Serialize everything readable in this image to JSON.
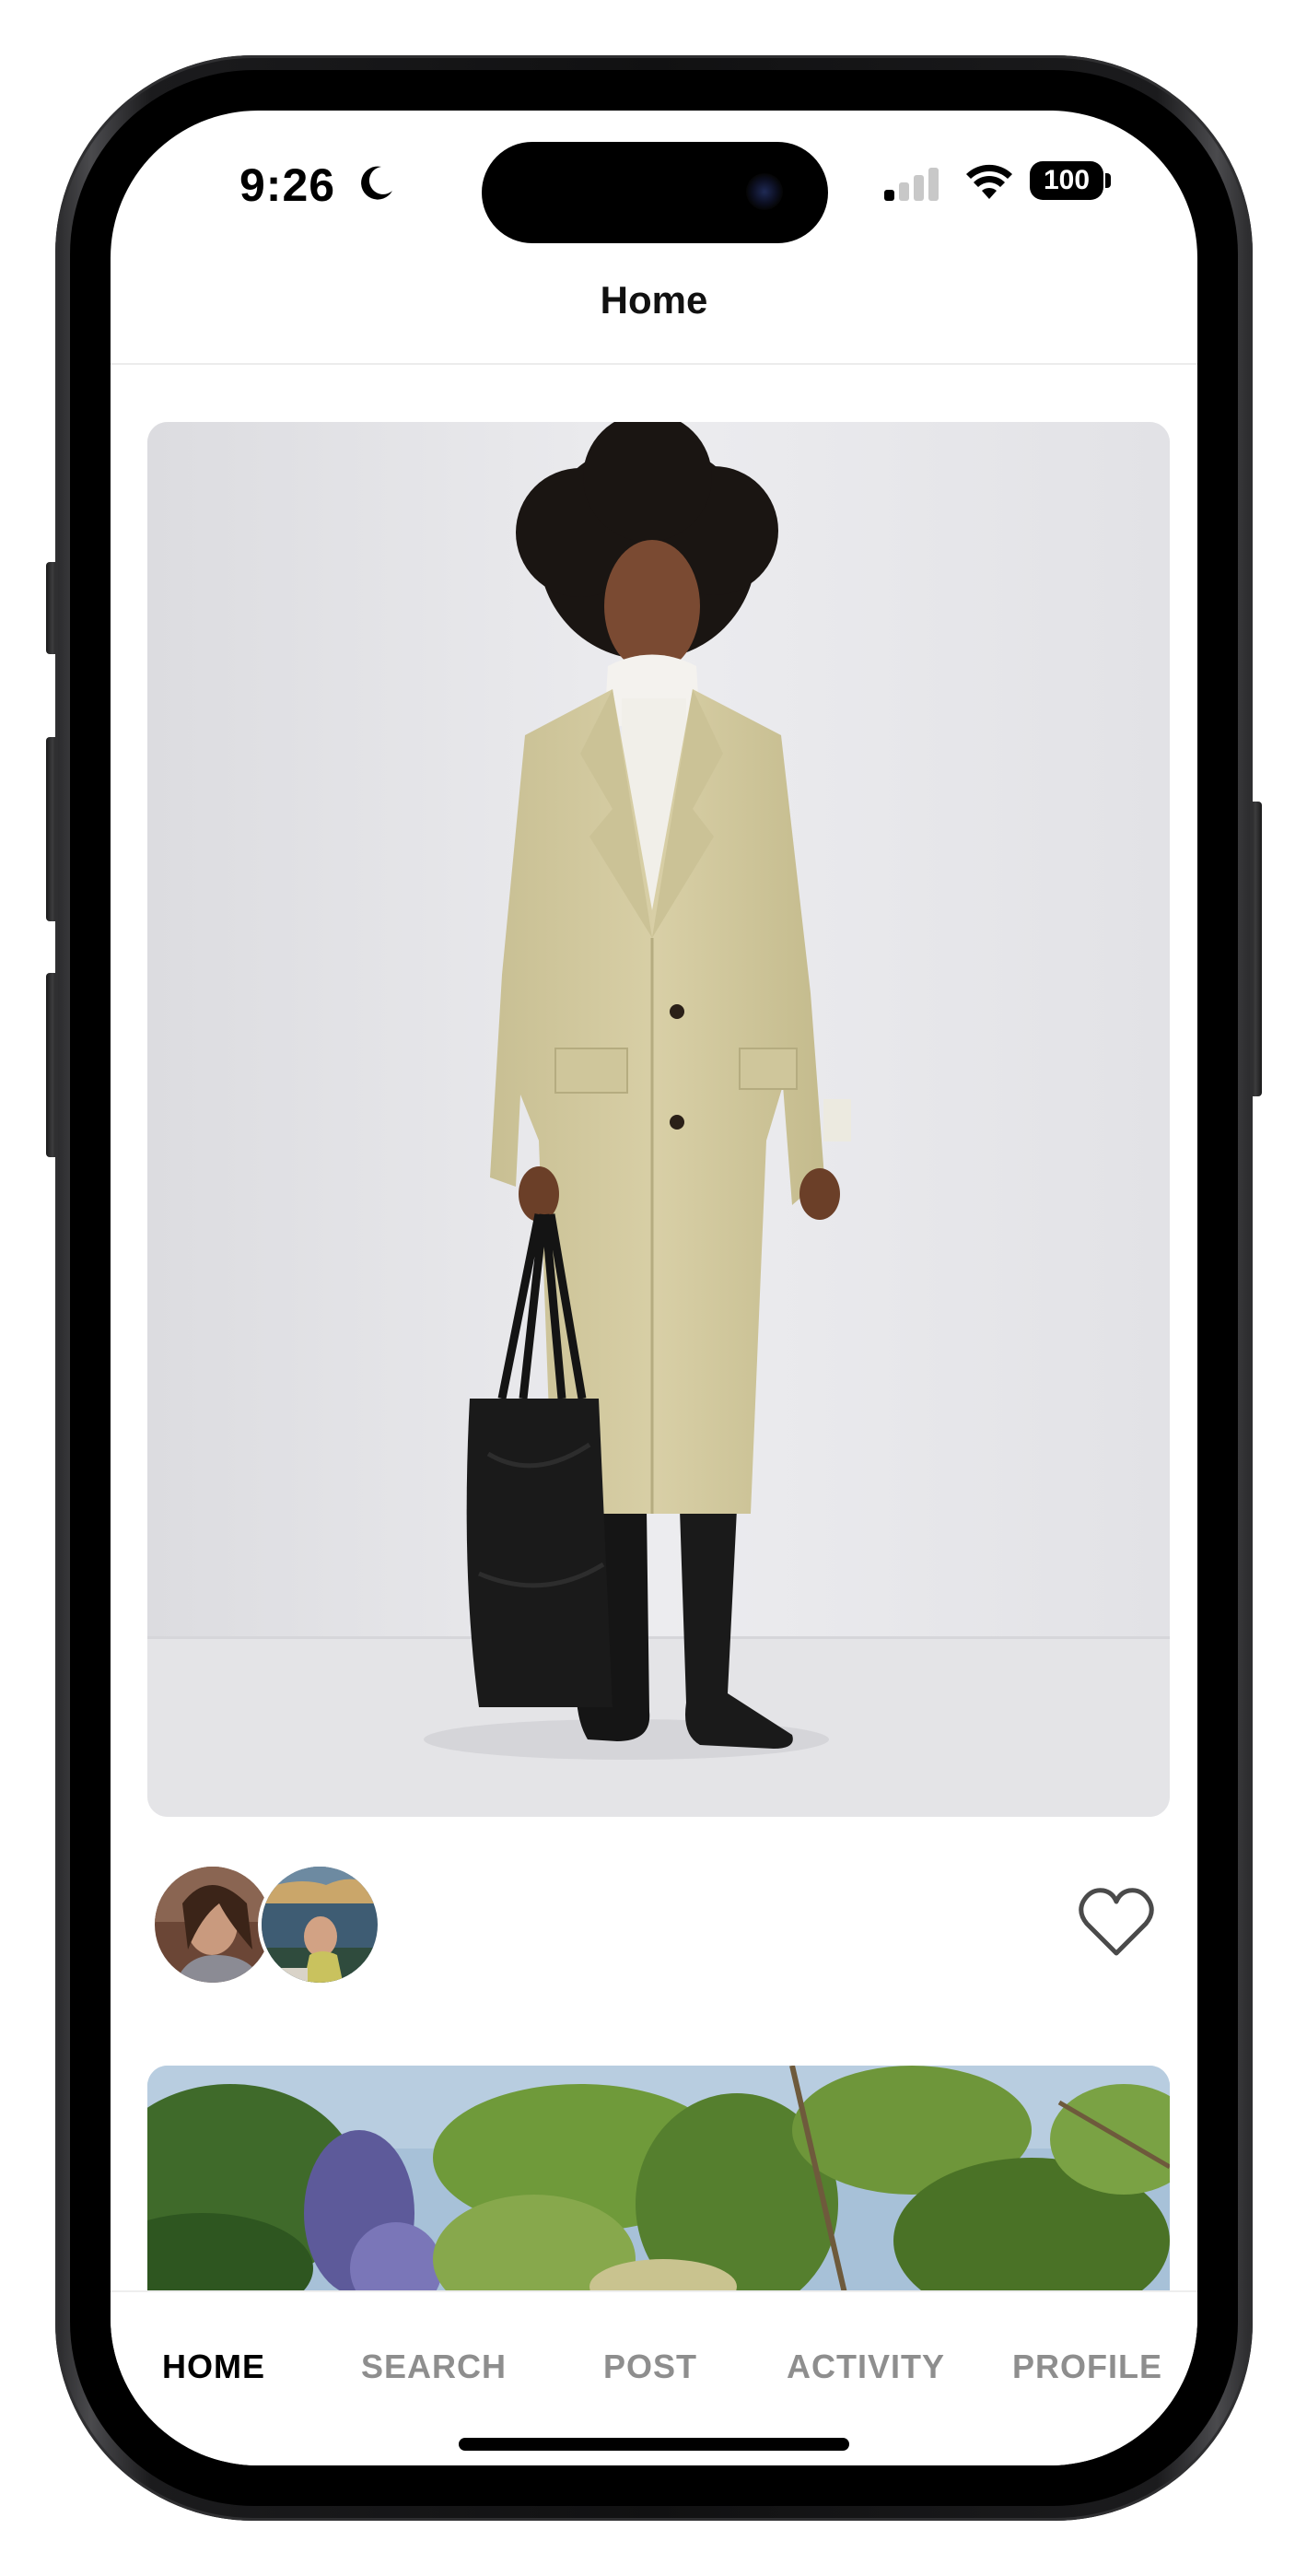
{
  "status_bar": {
    "time": "9:26",
    "battery": "100",
    "icons": [
      "moon-icon",
      "signal-icon",
      "wifi-icon",
      "battery-icon"
    ]
  },
  "header": {
    "title": "Home"
  },
  "feed": {
    "posts": [
      {
        "avatars": [
          "avatar-1",
          "avatar-2"
        ],
        "liked": false,
        "like_icon": "heart-outline-icon"
      }
    ]
  },
  "tabbar": {
    "tabs": [
      {
        "label": "HOME",
        "active": true
      },
      {
        "label": "SEARCH",
        "active": false
      },
      {
        "label": "POST",
        "active": false
      },
      {
        "label": "ACTIVITY",
        "active": false
      },
      {
        "label": "PROFILE",
        "active": false
      }
    ]
  },
  "colors": {
    "active_tab": "#000000",
    "inactive_tab": "#8e8e8e",
    "coat": "#d2c9a0",
    "background": "#ffffff"
  }
}
